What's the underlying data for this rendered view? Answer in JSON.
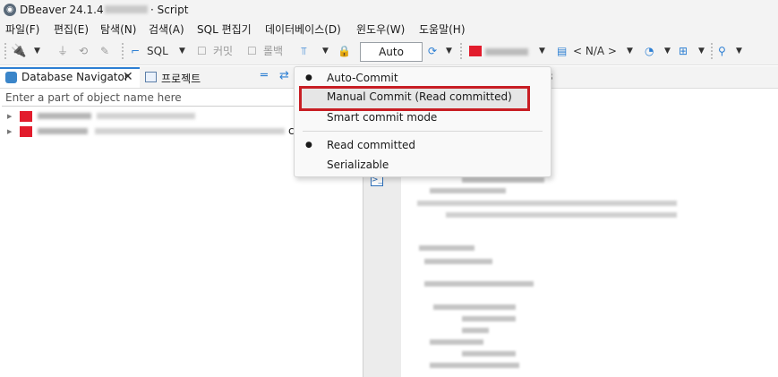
{
  "window": {
    "app_name": "DBeaver 24.1.4 -",
    "title_suffix": "· Script",
    "app_icon": "dbeaver-beaver-icon"
  },
  "menu": [
    "파일(F)",
    "편집(E)",
    "탐색(N)",
    "검색(A)",
    "SQL 편집기",
    "데이터베이스(D)",
    "윈도우(W)",
    "도움말(H)"
  ],
  "toolbar": {
    "sql_label": "SQL",
    "commit_label": "커밋",
    "rollback_label": "롤백",
    "transaction_mode_value": "Auto",
    "schema_value": "< N/A >",
    "icons": [
      "new-connection-icon",
      "disconnect-icon",
      "reconnect-icon",
      "invalidate-icon",
      "sql-editor-icon",
      "commit-icon",
      "rollback-icon",
      "transaction-mode-icon",
      "lock-icon",
      "history-icon",
      "schema-icon",
      "dashboard-icon",
      "tools-icon",
      "search-icon"
    ]
  },
  "navigator": {
    "tab_label": "Database Navigator",
    "project_tab_label": "프로젝트",
    "filter_placeholder": "Enter a part of object name here",
    "tree_trailing_char": "c"
  },
  "editor": {
    "tab_number_fragment": "3"
  },
  "transaction_menu": {
    "items": [
      {
        "label": "Auto-Commit",
        "bullet": true
      },
      {
        "label": "Manual Commit (Read committed)",
        "bullet": false,
        "highlighted": true
      },
      {
        "label": "Smart commit mode",
        "bullet": false
      },
      {
        "label": "Read committed",
        "bullet": true
      },
      {
        "label": "Serializable",
        "bullet": false
      }
    ]
  },
  "colors": {
    "accent": "#2d7fd3",
    "highlight_border": "#c81e24",
    "connection_badge": "#e21c2c"
  }
}
